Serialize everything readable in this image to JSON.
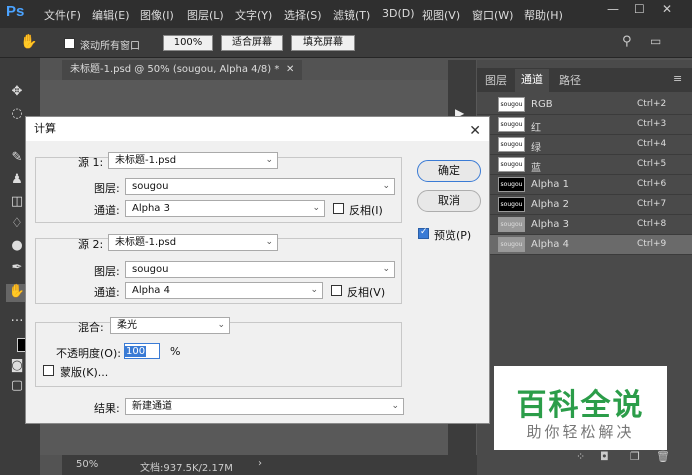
{
  "app": {
    "logo": "Ps"
  },
  "menu": [
    "文件(F)",
    "编辑(E)",
    "图像(I)",
    "图层(L)",
    "文字(Y)",
    "选择(S)",
    "滤镜(T)",
    "3D(D)",
    "视图(V)",
    "窗口(W)",
    "帮助(H)"
  ],
  "window_controls": {
    "minimize": "—",
    "maximize": "☐",
    "close": "✕"
  },
  "options": {
    "scroll_all": "滚动所有窗口",
    "zoom": "100%",
    "fit_screen": "适合屏幕",
    "fill_screen": "填充屏幕"
  },
  "document": {
    "tab": "未标题-1.psd @ 50% (sougou, Alpha 4/8) *",
    "close": "✕",
    "zoom": "50%",
    "info": "文档:937.5K/2.17M"
  },
  "panel": {
    "tabs": [
      "图层",
      "通道",
      "路径"
    ],
    "active_tab": "通道",
    "channels": [
      {
        "name": "RGB",
        "key": "Ctrl+2",
        "thumb": "sougou",
        "dark": false
      },
      {
        "name": "红",
        "key": "Ctrl+3",
        "thumb": "sougou",
        "dark": false
      },
      {
        "name": "绿",
        "key": "Ctrl+4",
        "thumb": "sougou",
        "dark": false
      },
      {
        "name": "蓝",
        "key": "Ctrl+5",
        "thumb": "sougou",
        "dark": false
      },
      {
        "name": "Alpha 1",
        "key": "Ctrl+6",
        "thumb": "sougou",
        "dark": true
      },
      {
        "name": "Alpha 2",
        "key": "Ctrl+7",
        "thumb": "sougou",
        "dark": true
      },
      {
        "name": "Alpha 3",
        "key": "Ctrl+8",
        "thumb": "sougou",
        "dark": "grey"
      },
      {
        "name": "Alpha 4",
        "key": "Ctrl+9",
        "thumb": "sougou",
        "dark": "grey",
        "selected": true
      }
    ]
  },
  "dialog": {
    "title": "计算",
    "close": "✕",
    "source1": {
      "label": "源 1:",
      "file": "未标题-1.psd",
      "layer_label": "图层:",
      "layer": "sougou",
      "channel_label": "通道:",
      "channel": "Alpha 3",
      "invert": "反相(I)"
    },
    "source2": {
      "label": "源 2:",
      "file": "未标题-1.psd",
      "layer_label": "图层:",
      "layer": "sougou",
      "channel_label": "通道:",
      "channel": "Alpha 4",
      "invert": "反相(V)"
    },
    "blend": {
      "label": "混合:",
      "mode": "柔光",
      "opacity_label": "不透明度(O):",
      "opacity": "100",
      "unit": "%",
      "mask": "蒙版(K)..."
    },
    "result": {
      "label": "结果:",
      "value": "新建通道"
    },
    "ok": "确定",
    "cancel": "取消",
    "preview": "预览(P)"
  },
  "watermark": {
    "title": "百科全说",
    "subtitle": "助你轻松解决"
  }
}
